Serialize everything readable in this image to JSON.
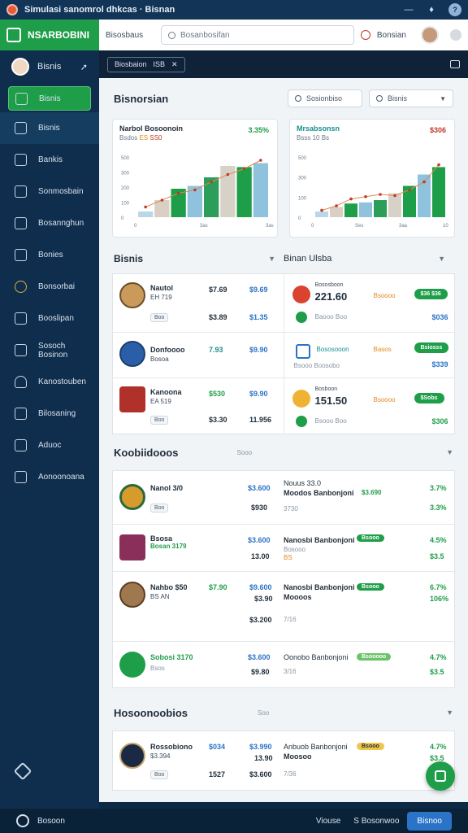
{
  "titlebar": {
    "title": "Simulasi sanomrol dhkcas · Bisnan"
  },
  "brand": {
    "name": "NSARBOBINI"
  },
  "profile": {
    "name": "Bisnis"
  },
  "sidebar": {
    "items": [
      {
        "label": "Bisnis",
        "icon": "bisnis-icon"
      },
      {
        "label": "Bisnis",
        "icon": "chart-icon"
      },
      {
        "label": "Bankis",
        "icon": "bank-icon"
      },
      {
        "label": "Sonmosbain",
        "icon": "people-icon"
      },
      {
        "label": "Bosannghun",
        "icon": "analytics-icon"
      },
      {
        "label": "Bonies",
        "icon": "list-icon"
      },
      {
        "label": "Bonsorbai",
        "icon": "coin-icon"
      },
      {
        "label": "Booslipan",
        "icon": "home-icon"
      },
      {
        "label": "Sosoch Bosinon",
        "icon": "table-icon"
      },
      {
        "label": "Kanostouben",
        "icon": "user-icon"
      },
      {
        "label": "Bilosaning",
        "icon": "doc-icon"
      },
      {
        "label": "Aduoc",
        "icon": "store-icon"
      },
      {
        "label": "Aonoonoana",
        "icon": "check-icon"
      }
    ]
  },
  "topbar": {
    "breadcrumb": "Bisosbaus",
    "search_placeholder": "Bosanbosifan",
    "username": "Bonsian"
  },
  "toolbar": {
    "pill_label": "Biosbaion",
    "pill_value": "ISB"
  },
  "overview": {
    "title": "Bisnorsian",
    "filter1": "Sosionbiso",
    "filter2": "Bisnis"
  },
  "charts": [
    {
      "title": "Narbol Bosoonoin",
      "subtitle": "Bsdos",
      "sub_value1": "ES",
      "sub_value2": "SS0",
      "value": "3.35%",
      "value_color": "#1f9e4a",
      "chart_data": {
        "type": "bar",
        "y_ticks": [
          "500",
          "300",
          "200",
          "100",
          "0"
        ],
        "x_labels": [
          "0",
          "3as",
          "3as"
        ],
        "bars": [
          10,
          30,
          50,
          55,
          70,
          90,
          88,
          95
        ],
        "line": [
          18,
          30,
          42,
          48,
          62,
          75,
          85,
          100
        ]
      }
    },
    {
      "title": "Mrsabsonsn",
      "subtitle": "Bsss",
      "sub_value1": "10",
      "sub_value2": "Bs",
      "value": "$306",
      "value_color": "#c0392b",
      "chart_data": {
        "type": "bar",
        "y_ticks": [
          "500",
          "300",
          "100",
          "0"
        ],
        "x_labels": [
          "0",
          "Ses",
          "3aa",
          "10"
        ],
        "bars": [
          10,
          18,
          24,
          26,
          30,
          42,
          55,
          75,
          88
        ],
        "line": [
          12,
          20,
          32,
          36,
          40,
          38,
          48,
          62,
          92
        ]
      }
    }
  ],
  "bisnis": {
    "title": "Bisnis",
    "rows": [
      {
        "name": "Nautol",
        "sub": "EH 719",
        "tag": "Boo",
        "a": "$7.69",
        "b": "$9.69",
        "c": "$3.89",
        "d": "$1.35"
      },
      {
        "name": "Donfoooo",
        "sub": "Bosoa",
        "tag": "",
        "a": "7.93",
        "b": "$9.90",
        "c": "",
        "d": ""
      },
      {
        "name": "Kanoona",
        "sub": "EA 519",
        "tag": "Boo",
        "a": "$530",
        "b": "$9.90",
        "c": "$3.30",
        "d": "11.956"
      }
    ]
  },
  "bisnis_right": {
    "title": "Binan Ulsba",
    "rows": [
      {
        "label": "Bososboon",
        "value": "221.60",
        "tag": "Bsoooo",
        "sub": "Baooo Boo",
        "pill": "$36 $36",
        "amount": "$036"
      },
      {
        "label": "Bososooon",
        "value": "",
        "tag": "Basos",
        "sub": "Bsooo Boosobo",
        "pill": "Bsiosss",
        "amount": "$339"
      },
      {
        "label": "Bosboon",
        "value": "151.50",
        "tag": "Bsoooo",
        "sub": "Bsooo Boo",
        "pill": "$Sobs",
        "amount": "$306"
      }
    ]
  },
  "koosi": {
    "title": "Koobiidooos",
    "subtitle": "Sooo",
    "rows": [
      {
        "name": "Nanol 3/0",
        "sub": "Boo",
        "a": "$3.600",
        "b": "$930",
        "r_name": "Nouus 33.0",
        "r_sub": "Moodos Banbonjoni",
        "r_tag": "$3.690",
        "r_small": "3730",
        "p1": "3.7%",
        "p2": "3.3%"
      },
      {
        "name": "Bsosa",
        "sub": "Bosan 3179",
        "a": "$3.600",
        "b": "13.00",
        "r_name": "Nanosbi Banbonjoni",
        "r_sub": "Bosooo",
        "r_tag": "Bsooo",
        "r_small": "BS",
        "p1": "4.5%",
        "p2": "$3.5"
      },
      {
        "name": "Nahbo $50",
        "sub": "BS AN",
        "a": "$7.90",
        "b": "$9.600",
        "c": "$3.90",
        "d": "$3.200",
        "r_name": "Nanosbi Banbonjoni",
        "r_sub": "Moooos",
        "r_tag": "Bsooo",
        "r_small": "7/16",
        "p1": "6.7%",
        "p2": "106%"
      },
      {
        "name": "Sobosi 3170",
        "sub": "Bsos",
        "a": "$3.600",
        "b": "$9.80",
        "r_name": "Oonobo Banbonjoni",
        "r_sub": "",
        "r_tag": "Bsooooo",
        "r_small": "3/16",
        "p1": "4.7%",
        "p2": "$3.5"
      }
    ]
  },
  "hosa": {
    "title": "Hosoonoobios",
    "subtitle": "Soo",
    "rows": [
      {
        "name": "Rossobiono",
        "sub": "$3.394",
        "a": "$034",
        "b": "$3.990",
        "c": "13.90",
        "r_name": "Anbuob Banbonjoni",
        "r_sub": "Moosoo",
        "r_tag": "Bsooo",
        "r_small": "7/36",
        "p1": "4.7%",
        "p2": "$3.5",
        "x": "1527",
        "y": "$3.600"
      }
    ]
  },
  "statusbar": {
    "left": "Bosoon",
    "middle": "Viouse",
    "ver_label": "S Bosonwoo",
    "button": "Bisnoo"
  }
}
